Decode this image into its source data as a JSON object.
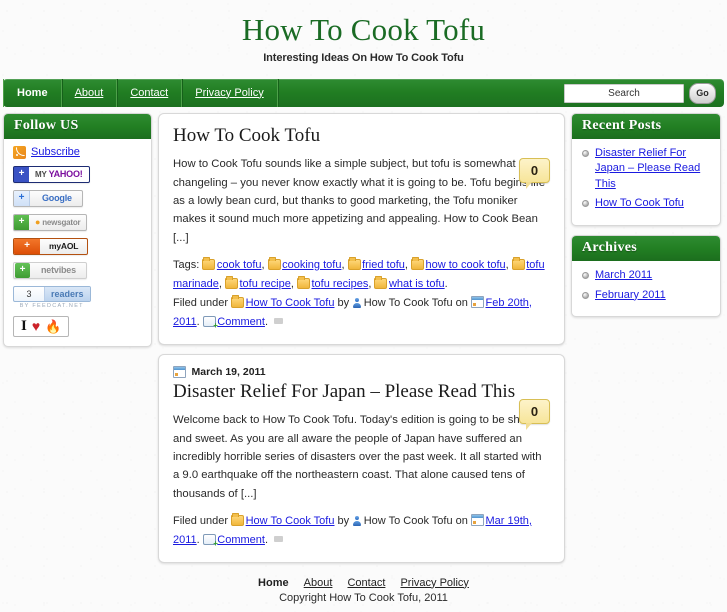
{
  "site": {
    "title": "How To Cook Tofu",
    "tagline": "Interesting Ideas On How To Cook Tofu"
  },
  "nav": {
    "items": [
      {
        "label": "Home",
        "active": true
      },
      {
        "label": "About",
        "active": false
      },
      {
        "label": "Contact",
        "active": false
      },
      {
        "label": "Privacy Policy",
        "active": false
      }
    ]
  },
  "search": {
    "value": "Search",
    "placeholder": "Search",
    "button_label": "Go"
  },
  "sidebar_left": {
    "widget_title": "Follow US",
    "subscribe_label": "Subscribe",
    "badges": [
      {
        "name": "my-yahoo",
        "plus": "+",
        "pre": "MY",
        "text": "YAHOO!"
      },
      {
        "name": "google",
        "plus": "+",
        "text": "Google"
      },
      {
        "name": "newsgator",
        "plus": "+",
        "text": "newsgator"
      },
      {
        "name": "my-aol",
        "plus": "+",
        "text": "myAOL"
      },
      {
        "name": "netvibes",
        "plus": "+",
        "text": "netvibes"
      }
    ],
    "feedcat": {
      "count": "3",
      "label": "readers",
      "attribution": "BY FEEDCAT.NET"
    },
    "iheart": {
      "i": "I",
      "heart": "♥",
      "flame": "🔥"
    }
  },
  "posts": [
    {
      "date_line": "",
      "title": "How To Cook Tofu",
      "excerpt": "How to Cook Tofu sounds like a simple subject, but tofu is somewhat of a changeling – you never know exactly what it is going to be.  Tofu begins life as a lowly bean curd, but thanks to good marketing, the Tofu moniker makes it sound much more appetizing and appealing.  How to Cook Bean [...]",
      "comment_count": "0",
      "tags_label": "Tags:",
      "tags": [
        "cook tofu",
        "cooking tofu",
        "fried tofu",
        "how to cook tofu",
        "tofu marinade",
        "tofu recipe",
        "tofu recipes",
        "what is tofu"
      ],
      "filed_under_label": "Filed under",
      "category": "How To Cook Tofu",
      "by_label": "by",
      "author": "How To Cook Tofu",
      "on_label": "on",
      "date": "Feb 20th, 2011",
      "comment_label": "Comment"
    },
    {
      "date_line": "March 19, 2011",
      "title": "Disaster Relief For Japan – Please Read This",
      "excerpt": "Welcome back to How To Cook Tofu.  Today's edition is going to be short and sweet. As you are all aware the people of Japan have suffered an incredibly horrible series of disasters over the past week.  It all started with a 9.0 earthquake off the northeastern coast.  That alone caused tens of thousands of [...]",
      "comment_count": "0",
      "tags_label": "",
      "tags": [],
      "filed_under_label": "Filed under",
      "category": "How To Cook Tofu",
      "by_label": "by",
      "author": "How To Cook Tofu",
      "on_label": "on",
      "date": "Mar 19th, 2011",
      "comment_label": "Comment"
    }
  ],
  "sidebar_right": {
    "widgets": [
      {
        "title": "Recent Posts",
        "items": [
          "Disaster Relief For Japan – Please Read This",
          "How To Cook Tofu"
        ]
      },
      {
        "title": "Archives",
        "items": [
          "March 2011",
          "February 2011"
        ]
      }
    ]
  },
  "footer": {
    "nav": [
      {
        "label": "Home",
        "active": true
      },
      {
        "label": "About",
        "active": false
      },
      {
        "label": "Contact",
        "active": false
      },
      {
        "label": "Privacy Policy",
        "active": false
      }
    ],
    "copyright": "Copyright How To Cook Tofu, 2011"
  },
  "colors": {
    "brand_green": "#1a6b24",
    "nav_green": "#227f23",
    "link_blue": "#1a1ae0",
    "bubble_yellow": "#f7e59a"
  }
}
